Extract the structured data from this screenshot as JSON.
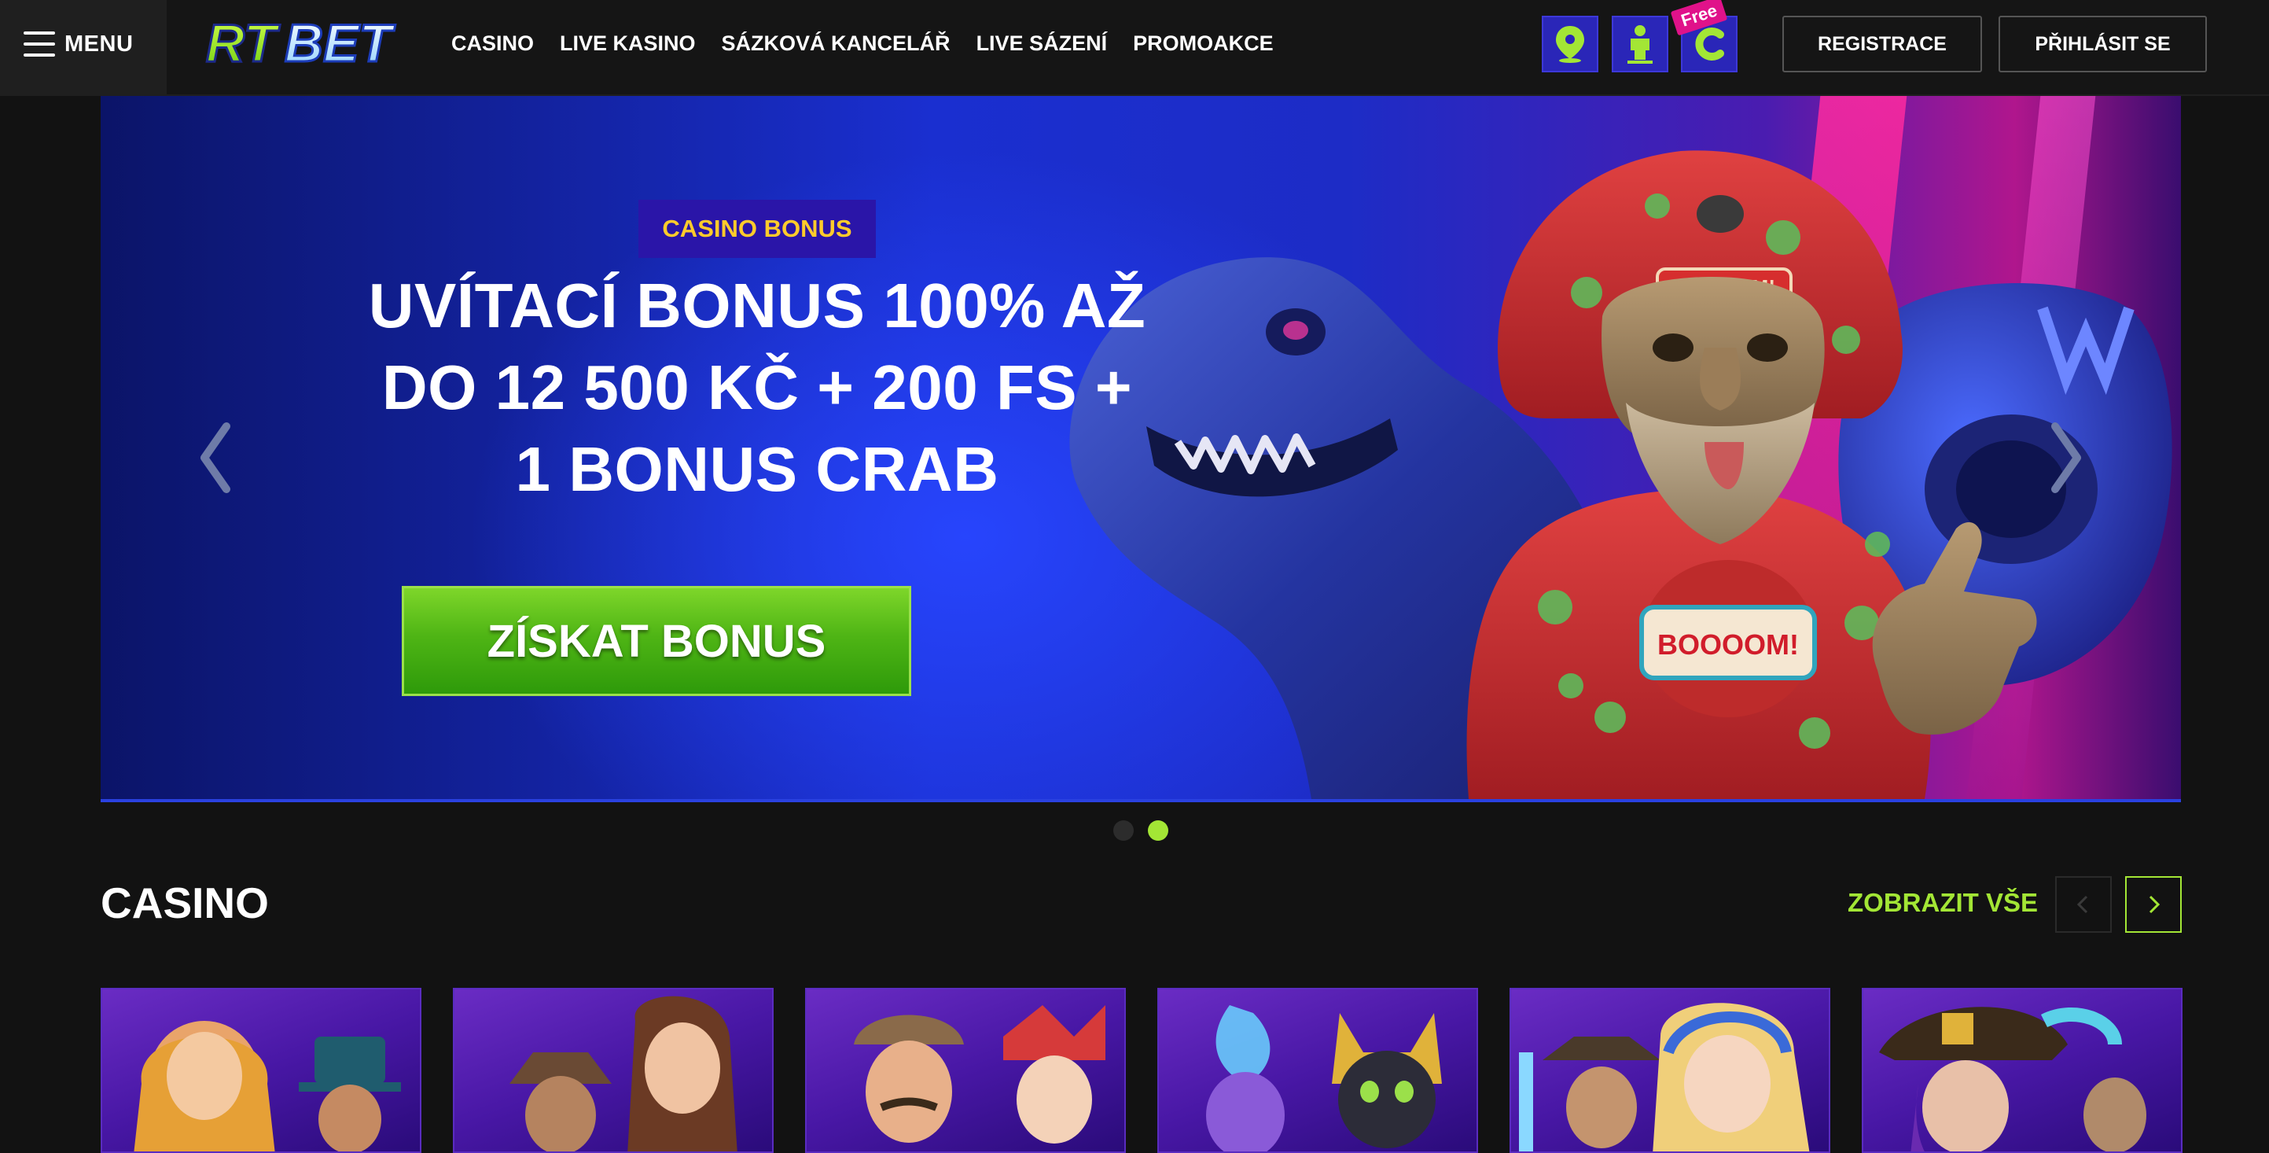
{
  "header": {
    "menu_label": "MENU",
    "logo_text": "RTBET",
    "nav": [
      "CASINO",
      "LIVE KASINO",
      "SÁZKOVÁ KANCELÁŘ",
      "LIVE SÁZENÍ",
      "PROMOAKCE"
    ],
    "free_badge": "Free",
    "register_label": "REGISTRACE",
    "login_label": "PŘIHLÁSIT SE"
  },
  "banner": {
    "tag": "CASINO BONUS",
    "headline_line1": "UVÍTACÍ BONUS 100% AŽ",
    "headline_line2": "DO 12 500 KČ + 200 FS +",
    "headline_line3": "1 BONUS CRAB",
    "cta_label": "ZÍSKAT BONUS",
    "character_text_1": "DOOOOM!",
    "character_text_2": "BOOOOM!",
    "active_slide": 2,
    "slide_count": 2
  },
  "casino": {
    "title": "CASINO",
    "view_all_label": "ZOBRAZIT VŠE"
  },
  "colors": {
    "accent_green": "#a3e635",
    "tag_text": "#ffcb2b",
    "icon_button": "#2a26b8",
    "free_badge": "#e0128a"
  },
  "icons": {
    "menu": "hamburger-icon",
    "locator": "map-pin-icon",
    "support": "person-icon",
    "free": "c-coin-icon",
    "prev": "chevron-left-icon",
    "next": "chevron-right-icon"
  }
}
